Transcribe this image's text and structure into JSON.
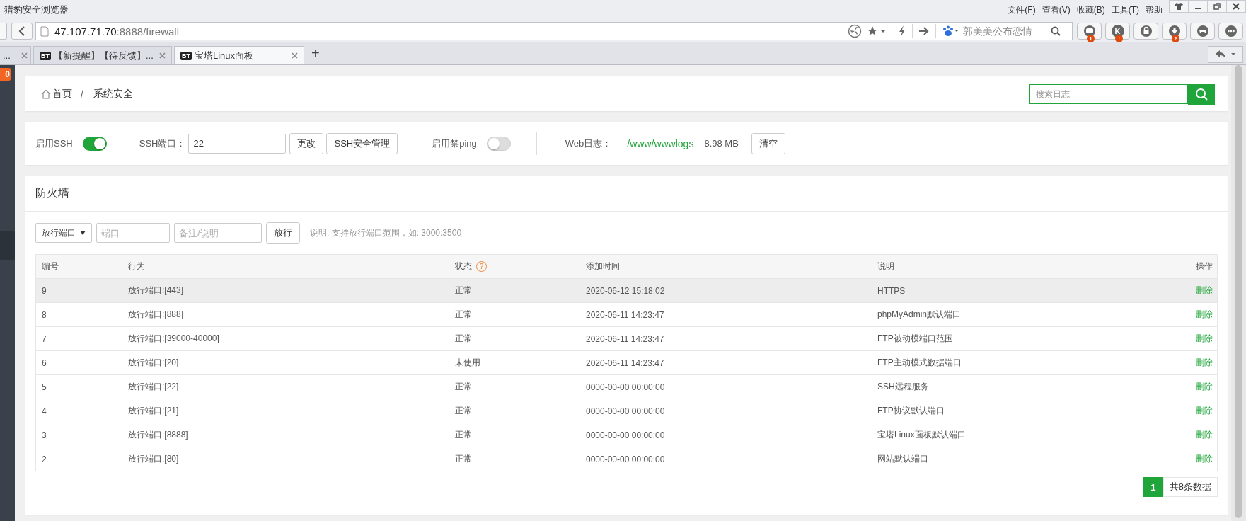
{
  "browser": {
    "title": "猎豹安全浏览器",
    "menu": [
      "文件(F)",
      "查看(V)",
      "收藏(B)",
      "工具(T)",
      "帮助"
    ],
    "url": {
      "host": "47.107.71.70",
      "rest": ":8888/firewall"
    },
    "search": {
      "placeholder": "郭美美公布恋情"
    },
    "tools": [
      {
        "kind": "chat",
        "badge": "1"
      },
      {
        "kind": "letter",
        "label": "K",
        "badge": "!"
      },
      {
        "kind": "lock"
      },
      {
        "kind": "download",
        "badge": "2"
      },
      {
        "kind": "game"
      },
      {
        "kind": "more"
      }
    ],
    "tabs": [
      {
        "title": "...",
        "selected": false
      },
      {
        "title": "【新提醒】【待反馈】...",
        "favicon": "BT",
        "selected": false
      },
      {
        "title": "宝塔Linux面板",
        "favicon": "BT",
        "selected": true
      }
    ],
    "new_tab": "+"
  },
  "sidebar": {
    "badge": "0"
  },
  "breadcrumb": [
    "首页",
    "系统安全"
  ],
  "breadcrumb_separator": "/",
  "log_search": {
    "placeholder": "搜索日志"
  },
  "settings": {
    "ssh": {
      "label": "启用SSH",
      "on": true
    },
    "port": {
      "label": "SSH端口：",
      "value": "22"
    },
    "buttons": [
      "更改",
      "SSH安全管理"
    ],
    "ping": {
      "label": "启用禁ping",
      "on": false
    },
    "weblog": {
      "label": "Web日志：",
      "path": "/www/wwwlogs",
      "size": "8.98 MB",
      "button": "清空"
    }
  },
  "firewall": {
    "title": "防火墙",
    "select": "放行端口",
    "port": {
      "placeholder": "端口"
    },
    "note": {
      "placeholder": "备注/说明"
    },
    "button": "放行",
    "hint": "说明: 支持放行端口范围，如: 3000:3500",
    "table": {
      "columns": [
        "编号",
        "行为",
        "状态",
        "添加时间",
        "说明",
        "操作"
      ],
      "status_help": "?",
      "rows": [
        {
          "id": "9",
          "action": "放行端口:[443]",
          "status": "正常",
          "time": "2020-06-12 15:18:02",
          "note": "HTTPS",
          "op": "删除",
          "hovered": true
        },
        {
          "id": "8",
          "action": "放行端口:[888]",
          "status": "正常",
          "time": "2020-06-11 14:23:47",
          "note": "phpMyAdmin默认端口",
          "op": "删除",
          "hovered": false
        },
        {
          "id": "7",
          "action": "放行端口:[39000-40000]",
          "status": "正常",
          "time": "2020-06-11 14:23:47",
          "note": "FTP被动模端口范围",
          "op": "删除",
          "hovered": false
        },
        {
          "id": "6",
          "action": "放行端口:[20]",
          "status": "未使用",
          "time": "2020-06-11 14:23:47",
          "note": "FTP主动模式数据端口",
          "op": "删除",
          "hovered": false
        },
        {
          "id": "5",
          "action": "放行端口:[22]",
          "status": "正常",
          "time": "0000-00-00 00:00:00",
          "note": "SSH远程服务",
          "op": "删除",
          "hovered": false
        },
        {
          "id": "4",
          "action": "放行端口:[21]",
          "status": "正常",
          "time": "0000-00-00 00:00:00",
          "note": "FTP协议默认端口",
          "op": "删除",
          "hovered": false
        },
        {
          "id": "3",
          "action": "放行端口:[8888]",
          "status": "正常",
          "time": "0000-00-00 00:00:00",
          "note": "宝塔Linux面板默认端口",
          "op": "删除",
          "hovered": false
        },
        {
          "id": "2",
          "action": "放行端口:[80]",
          "status": "正常",
          "time": "0000-00-00 00:00:00",
          "note": "网站默认端口",
          "op": "删除",
          "hovered": false
        }
      ]
    },
    "pagination": {
      "pages": [
        {
          "label": "1",
          "selected": true
        }
      ],
      "total": "共8条数据"
    }
  }
}
